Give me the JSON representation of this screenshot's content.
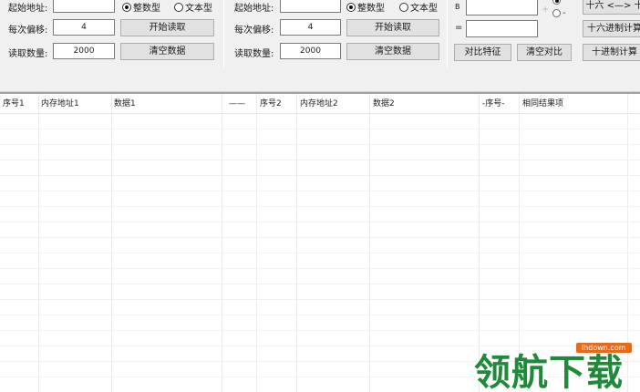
{
  "panel1": {
    "start_label": "起始地址:",
    "start_value": "",
    "radio_int": "整数型",
    "radio_text": "文本型",
    "offset_label": "每次偏移:",
    "offset_value": "4",
    "start_read_btn": "开始读取",
    "count_label": "读取数量:",
    "count_value": "2000",
    "clear_btn": "清空数据"
  },
  "panel2": {
    "start_label": "起始地址:",
    "start_value": "",
    "radio_int": "整数型",
    "radio_text": "文本型",
    "offset_label": "每次偏移:",
    "offset_value": "4",
    "start_read_btn": "开始读取",
    "count_label": "读取数量:",
    "count_value": "2000",
    "clear_btn": "清空数据"
  },
  "panel3": {
    "b_label": "B",
    "eq_label": "=",
    "plus_label": "+",
    "minus_label": "-",
    "compare_btn": "对比特征",
    "clear_compare_btn": "清空对比",
    "hex_conv_btn": "十六 <—> 十",
    "hex_calc_btn": "十六进制计算",
    "dec_calc_btn": "十进制计算"
  },
  "table": {
    "headers": [
      "序号1",
      "内存地址1",
      "数据1",
      "——",
      "序号2",
      "内存地址2",
      "数据2",
      "-序号-",
      "相同结果项"
    ]
  },
  "watermark": {
    "text": "领航下载",
    "url": "lhdown.com"
  }
}
